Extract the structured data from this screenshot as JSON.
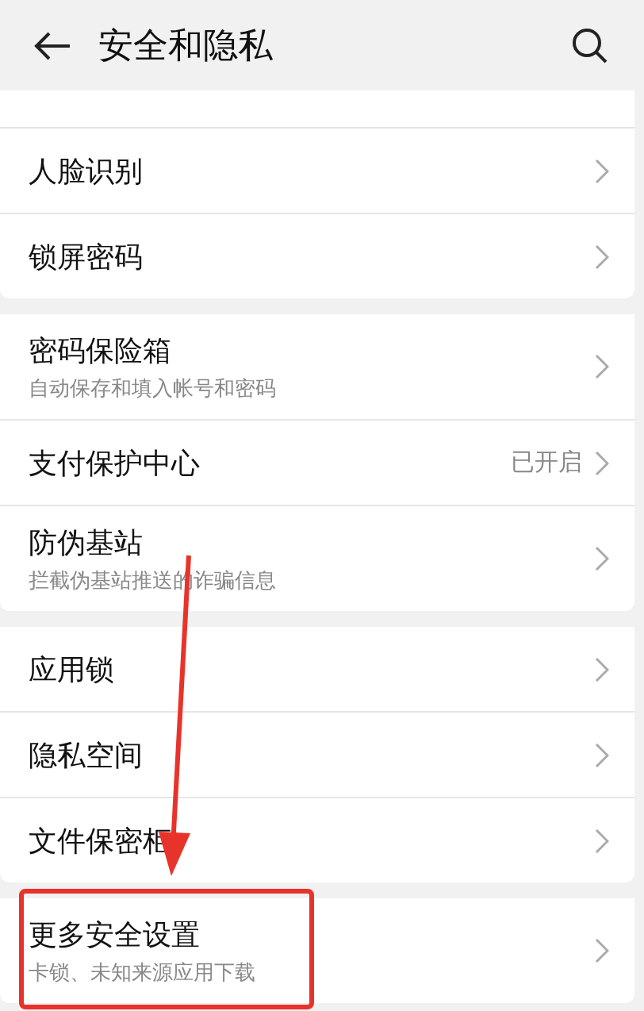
{
  "header": {
    "title": "安全和隐私"
  },
  "groups": [
    {
      "items": [
        {
          "title": "人脸识别"
        },
        {
          "title": "锁屏密码"
        }
      ]
    },
    {
      "items": [
        {
          "title": "密码保险箱",
          "subtitle": "自动保存和填入帐号和密码"
        },
        {
          "title": "支付保护中心",
          "value": "已开启"
        },
        {
          "title": "防伪基站",
          "subtitle": "拦截伪基站推送的诈骗信息"
        }
      ]
    },
    {
      "items": [
        {
          "title": "应用锁"
        },
        {
          "title": "隐私空间"
        },
        {
          "title": "文件保密柜"
        }
      ]
    },
    {
      "items": [
        {
          "title": "更多安全设置",
          "subtitle": "卡锁、未知来源应用下载"
        }
      ]
    }
  ]
}
